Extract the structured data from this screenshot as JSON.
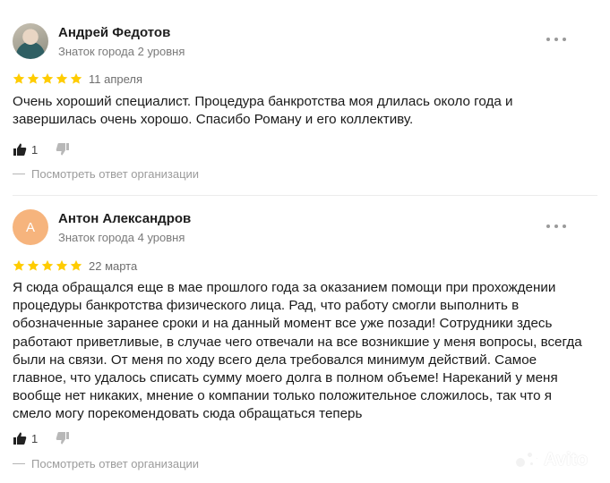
{
  "reviews": [
    {
      "author": "Андрей Федотов",
      "level": "Знаток города 2 уровня",
      "avatar_type": "photo",
      "rating": 5,
      "date": "11 апреля",
      "text": "Очень хороший специалист. Процедура банкротства моя длилась около года и завершилась очень хорошо. Спасибо Роману и его коллективу.",
      "likes": "1",
      "reply_link": "Посмотреть ответ организации"
    },
    {
      "author": "Антон Александров",
      "level": "Знаток города 4 уровня",
      "avatar_type": "letter",
      "avatar_letter": "А",
      "rating": 5,
      "date": "22 марта",
      "text": "Я сюда обращался еще в мае прошлого года за оказанием помощи при прохождении процедуры банкротства физического лица. Рад, что работу смогли выполнить в обозначенные заранее сроки и на данный момент все уже позади! Сотрудники здесь работают приветливые, в случае чего отвечали на все возникшие у меня вопросы, всегда были на связи. От меня по ходу всего дела требовался минимум действий. Самое главное, что удалось списать сумму моего долга в полном объеме! Нареканий у меня вообще нет никаких, мнение о компании только положительное сложилось, так что я смело могу порекомендовать сюда обращаться теперь",
      "likes": "1",
      "reply_link": "Посмотреть ответ организации"
    }
  ],
  "colors": {
    "star": "#fc0",
    "avatar_letter_bg": "#f6b47d"
  },
  "watermark": "Avito"
}
